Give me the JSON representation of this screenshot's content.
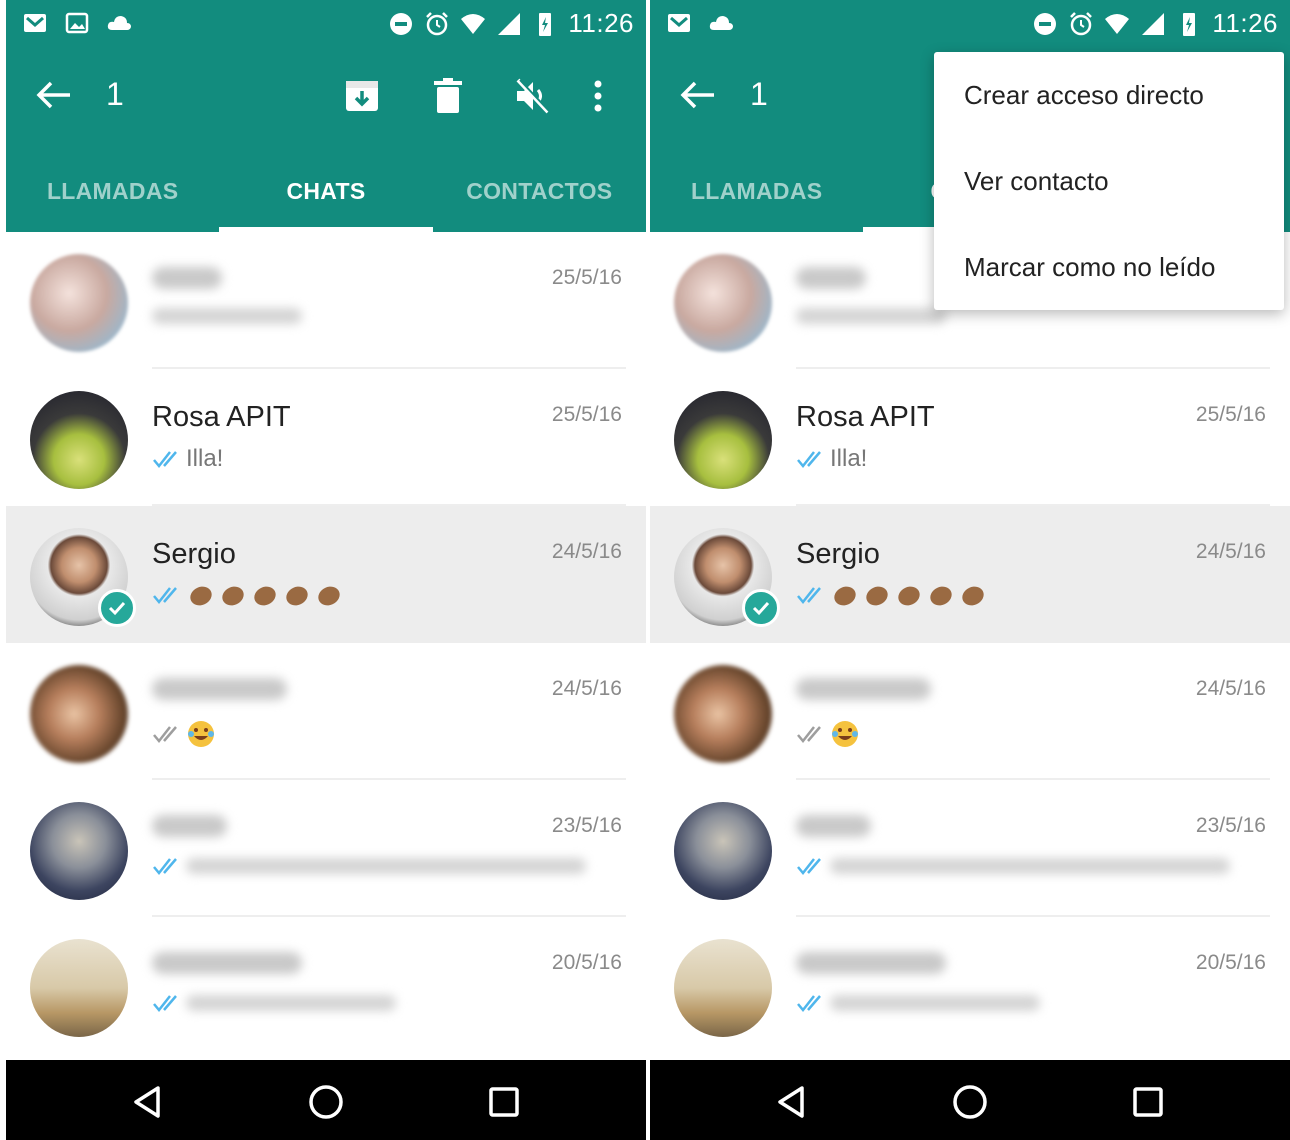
{
  "status_bar": {
    "time": "11:26"
  },
  "toolbar": {
    "selected_count": "1"
  },
  "tabs": [
    {
      "label": "LLAMADAS",
      "active": false
    },
    {
      "label": "CHATS",
      "active": true
    },
    {
      "label": "CONTACTOS",
      "active": false
    }
  ],
  "chats": [
    {
      "name": "",
      "date": "25/5/16",
      "message": "",
      "ticks": "none",
      "selected": false
    },
    {
      "name": "Rosa APIT",
      "date": "25/5/16",
      "message": "Illa!",
      "ticks": "blue",
      "selected": false
    },
    {
      "name": "Sergio",
      "date": "24/5/16",
      "message": "",
      "ticks": "blue",
      "selected": true
    },
    {
      "name": "",
      "date": "24/5/16",
      "message": "",
      "ticks": "grey",
      "selected": false
    },
    {
      "name": "",
      "date": "23/5/16",
      "message": "",
      "ticks": "blue",
      "selected": false
    },
    {
      "name": "",
      "date": "20/5/16",
      "message": "",
      "ticks": "blue",
      "selected": false
    }
  ],
  "menu": {
    "items": [
      "Crear acceso directo",
      "Ver contacto",
      "Marcar como no leído"
    ]
  },
  "colors": {
    "primary": "#128c7e",
    "accent": "#26a89a",
    "tick_blue": "#4fb6ec",
    "tick_grey": "#9e9e9e"
  },
  "icons": {
    "toolbar": [
      "back-arrow-icon",
      "archive-icon",
      "delete-icon",
      "mute-icon",
      "more-vert-icon"
    ],
    "nav": [
      "back-triangle-icon",
      "home-circle-icon",
      "recents-square-icon"
    ]
  }
}
